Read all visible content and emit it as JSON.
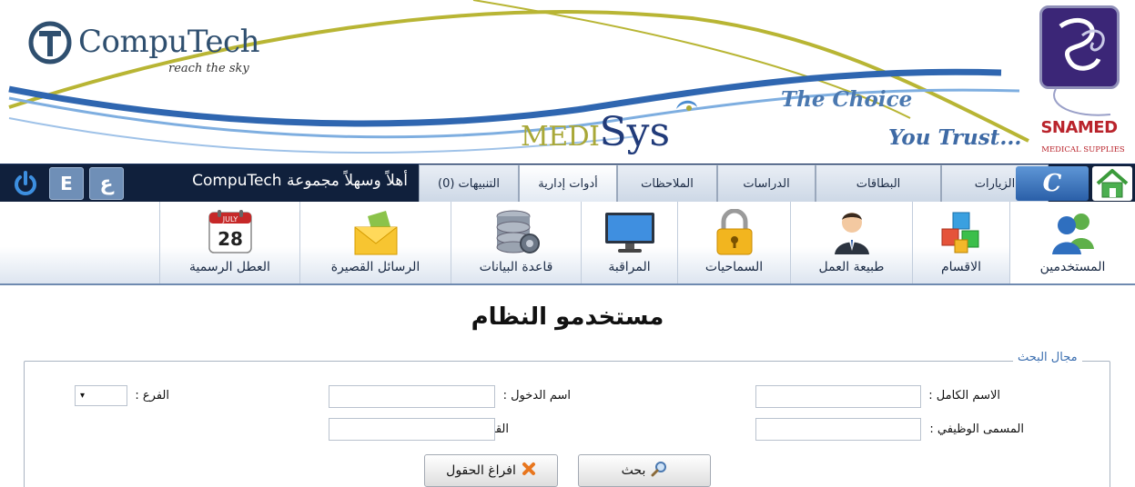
{
  "header": {
    "computech_name": "CompuTech",
    "computech_tagline": "reach the sky",
    "medisys_medi": "MEDI",
    "medisys_sys": "Sys",
    "choice_line1": "The Choice",
    "choice_line2": "You Trust...",
    "snamed_name": "SNAMED",
    "snamed_sub": "MEDICAL SUPPLIES"
  },
  "navbar": {
    "power_icon": "power-icon",
    "english_button": "E",
    "arabic_button": "ع",
    "welcome": "أهلاً وسهلاً مجموعة CompuTech",
    "tabs": [
      {
        "label": "التنبيهات (0)"
      },
      {
        "label": "أدوات إدارية"
      },
      {
        "label": "الملاحظات"
      },
      {
        "label": "الدراسات"
      },
      {
        "label": "البطاقات"
      },
      {
        "label": "الزيارات"
      }
    ],
    "c_button": "C",
    "home_icon": "home-icon"
  },
  "toolbar": {
    "items": [
      {
        "label": "العطل الرسمية",
        "icon": "calendar-icon",
        "calendar_month": "JULY",
        "calendar_day": "28"
      },
      {
        "label": "الرسائل القصيرة",
        "icon": "envelope-icon"
      },
      {
        "label": "قاعدة البيانات",
        "icon": "database-icon"
      },
      {
        "label": "المراقبة",
        "icon": "monitor-icon"
      },
      {
        "label": "السماحيات",
        "icon": "padlock-icon"
      },
      {
        "label": "طبيعة العمل",
        "icon": "businessman-icon"
      },
      {
        "label": "الاقسام",
        "icon": "cubes-icon"
      },
      {
        "label": "المستخدمين",
        "icon": "users-icon"
      }
    ]
  },
  "page": {
    "title": "مستخدمو النظام",
    "search_legend": "مجال البحث",
    "fields": {
      "full_name_label": "الاسم الكامل :",
      "full_name_value": "",
      "job_title_label": "المسمى الوظيفي :",
      "job_title_value": "",
      "login_name_label": "اسم الدخول :",
      "login_name_value": "",
      "department_label": "القسم :",
      "department_value": "",
      "branch_label": "الفرع :",
      "branch_value": "▾"
    },
    "buttons": {
      "search_label": "بحث",
      "clear_label": "افراغ الحقول"
    }
  },
  "colors": {
    "navbar_bg": "#10203c",
    "accent_blue": "#3c6fb0",
    "swoosh_yellow": "#b8b534",
    "swoosh_blue": "#2f66b0"
  }
}
